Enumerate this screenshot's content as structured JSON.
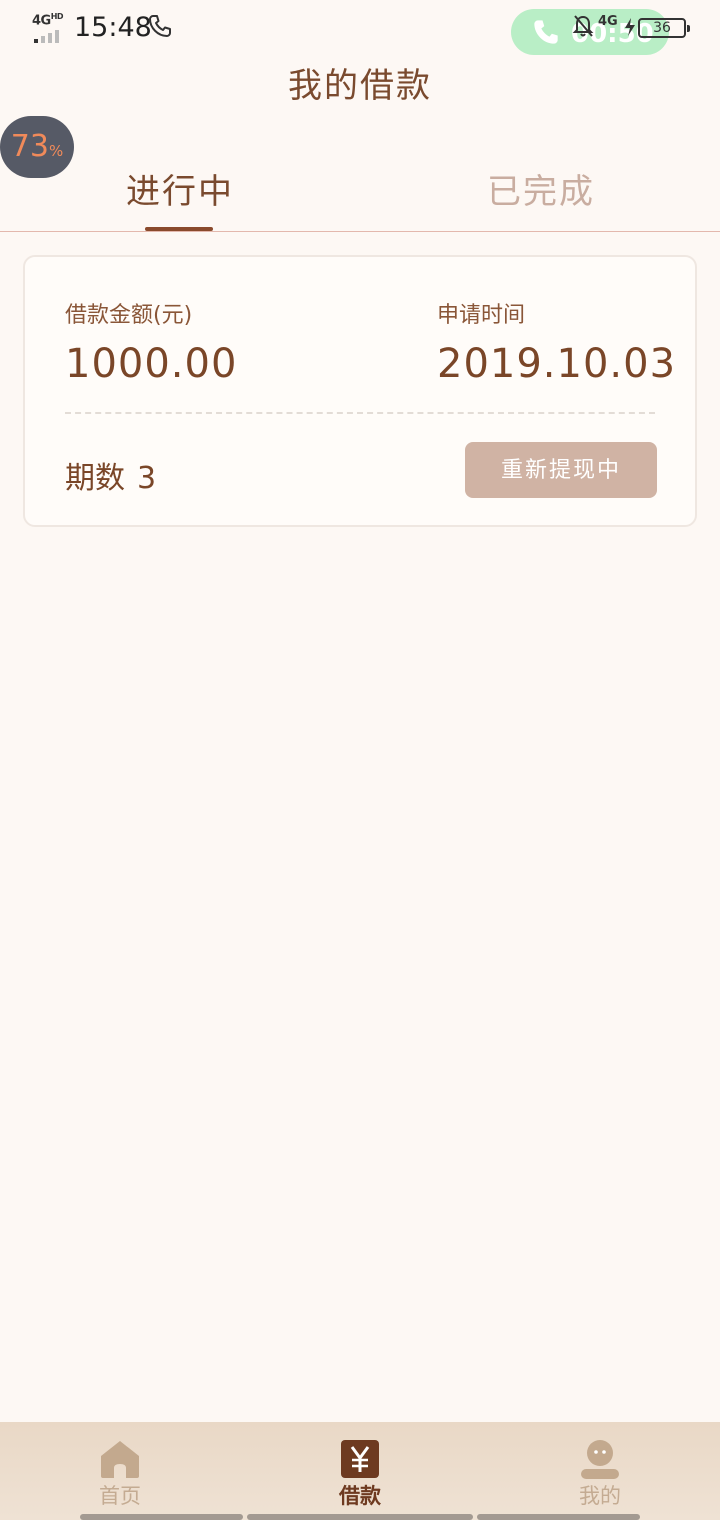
{
  "status_bar": {
    "network": "4G",
    "network_sup": "HD",
    "time": "15:48",
    "call_timer": "00:50",
    "network_right": "4G",
    "battery": "36"
  },
  "header": {
    "title": "我的借款"
  },
  "floating_badge": {
    "value": "73",
    "unit": "%"
  },
  "tabs": [
    {
      "label": "进行中",
      "active": true
    },
    {
      "label": "已完成",
      "active": false
    }
  ],
  "loan_card": {
    "amount_label": "借款金额(元)",
    "amount_value": "1000.00",
    "date_label": "申请时间",
    "date_value": "2019.10.03",
    "periods_label": "期数",
    "periods_value": "3",
    "status_button": "重新提现中"
  },
  "bottom_nav": [
    {
      "label": "首页",
      "icon": "home-icon",
      "active": false
    },
    {
      "label": "借款",
      "icon": "yen-icon",
      "active": true
    },
    {
      "label": "我的",
      "icon": "user-icon",
      "active": false
    }
  ],
  "colors": {
    "background": "#fdf8f4",
    "primary_text": "#7a4a2e",
    "inactive_tab": "#c9ada0",
    "button_bg": "#d0b3a4",
    "call_pill": "#b9eec6"
  }
}
